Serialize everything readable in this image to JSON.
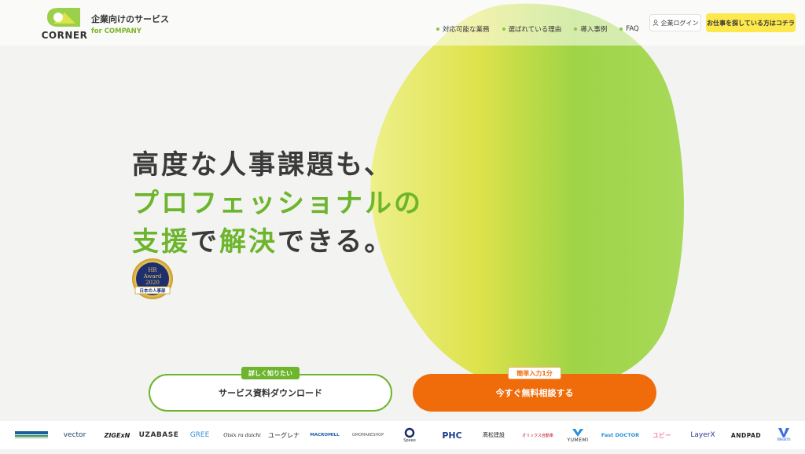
{
  "brand": {
    "logo_text": "CORNER",
    "subtitle": "企業向けのサービス",
    "subtitle_en": "for COMPANY"
  },
  "nav": {
    "items": [
      "対応可能な業務",
      "選ばれている理由",
      "導入事例",
      "FAQ"
    ],
    "login": "企業ログイン",
    "job_seekers": "お仕事を探している方はコチラ"
  },
  "hero": {
    "line1": "高度な人事課題も、",
    "line2": "プロフェッショナルの",
    "line3_a": "支援",
    "line3_b": "で",
    "line3_c": "解決",
    "line3_d": "できる。"
  },
  "award": {
    "line1": "HR",
    "line2": "Award",
    "year": "2020",
    "ribbon": "日本の人事部"
  },
  "cta": {
    "download_tag": "詳しく知りたい",
    "download_label": "サービス資料ダウンロード",
    "consult_tag": "簡単入力1分",
    "consult_label": "今すぐ無料相談する"
  },
  "clients": [
    "vector",
    "ZIGExN",
    "UZABASE",
    "GREE",
    "Oisix ra daichi",
    "ユーグレナ",
    "MACROMILL",
    "GMOMAKESHOP",
    "Speee",
    "PHC",
    "髙松建設",
    "オリックス自動車",
    "YUMEMI",
    "Fast DOCTOR",
    "ユビー",
    "LayerX",
    "ANDPAD",
    "Wealth"
  ],
  "colors": {
    "accent_green": "#6cb52d",
    "cta_orange": "#f06c0b",
    "job_yellow": "#fde84d"
  }
}
